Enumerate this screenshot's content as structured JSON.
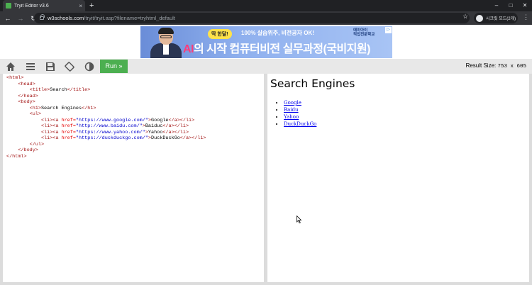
{
  "browser": {
    "tab_title": "Tryit Editor v3.6",
    "tab_close": "×",
    "new_tab": "+",
    "url_host": "w3schools.com",
    "url_path": "/tryit/tryit.asp?filename=tryhtml_default",
    "profile_name": "시크릿 모드(2개)"
  },
  "ad": {
    "pill": "딱 한달!",
    "headline": "100% 실습위주, 비전공자 OK!",
    "main_ai": "AI",
    "main_rest": "의 시작 컴퓨터비전 실무과정(국비지원)",
    "logo_line1": "에이아이",
    "logo_line2": "직업전문학교"
  },
  "toolbar": {
    "run_label": "Run »",
    "result_size_label": "Result Size:",
    "result_size_value": "753 x 605"
  },
  "code_lines": [
    [
      {
        "c": "tag",
        "t": "<html>"
      }
    ],
    [
      {
        "c": "",
        "t": "    "
      },
      {
        "c": "tag",
        "t": "<head>"
      }
    ],
    [
      {
        "c": "",
        "t": "        "
      },
      {
        "c": "tag",
        "t": "<title>"
      },
      {
        "c": "",
        "t": "Search"
      },
      {
        "c": "tag",
        "t": "</title>"
      }
    ],
    [
      {
        "c": "",
        "t": "    "
      },
      {
        "c": "tag",
        "t": "</head>"
      }
    ],
    [
      {
        "c": "",
        "t": "    "
      },
      {
        "c": "tag",
        "t": "<body>"
      }
    ],
    [
      {
        "c": "",
        "t": "        "
      },
      {
        "c": "tag",
        "t": "<h1>"
      },
      {
        "c": "",
        "t": "Search Engines"
      },
      {
        "c": "tag",
        "t": "</h1>"
      }
    ],
    [
      {
        "c": "",
        "t": "        "
      },
      {
        "c": "tag",
        "t": "<ul>"
      }
    ],
    [
      {
        "c": "",
        "t": "            "
      },
      {
        "c": "tag",
        "t": "<li><a "
      },
      {
        "c": "attr",
        "t": "href="
      },
      {
        "c": "val",
        "t": "\"https://www.google.com/\""
      },
      {
        "c": "tag",
        "t": ">"
      },
      {
        "c": "",
        "t": "Google"
      },
      {
        "c": "tag",
        "t": "</a></li>"
      }
    ],
    [
      {
        "c": "",
        "t": "            "
      },
      {
        "c": "tag",
        "t": "<li><a "
      },
      {
        "c": "attr",
        "t": "href="
      },
      {
        "c": "val",
        "t": "\"http://www.baidu.com/\""
      },
      {
        "c": "tag",
        "t": ">"
      },
      {
        "c": "",
        "t": "Baiduc"
      },
      {
        "c": "tag",
        "t": "</a></li>"
      }
    ],
    [
      {
        "c": "",
        "t": "            "
      },
      {
        "c": "tag",
        "t": "<li><a "
      },
      {
        "c": "attr",
        "t": "href="
      },
      {
        "c": "val",
        "t": "\"https://www.yahoo.com/\""
      },
      {
        "c": "tag",
        "t": ">"
      },
      {
        "c": "",
        "t": "Yahoo"
      },
      {
        "c": "tag",
        "t": "</a></li>"
      }
    ],
    [
      {
        "c": "",
        "t": "            "
      },
      {
        "c": "tag",
        "t": "<li><a "
      },
      {
        "c": "attr",
        "t": "href="
      },
      {
        "c": "val",
        "t": "\"https://duckduckgo.com/\""
      },
      {
        "c": "tag",
        "t": ">"
      },
      {
        "c": "",
        "t": "DuckDuckGo"
      },
      {
        "c": "tag",
        "t": "</a></li>"
      }
    ],
    [
      {
        "c": "",
        "t": "        "
      },
      {
        "c": "tag",
        "t": "</ul>"
      }
    ],
    [
      {
        "c": "",
        "t": "    "
      },
      {
        "c": "tag",
        "t": "</body>"
      }
    ],
    [
      {
        "c": "tag",
        "t": "</html>"
      }
    ]
  ],
  "result": {
    "heading": "Search Engines",
    "links": [
      "Google",
      "Baidu",
      "Yahoo",
      "DuckDuckGo"
    ]
  }
}
